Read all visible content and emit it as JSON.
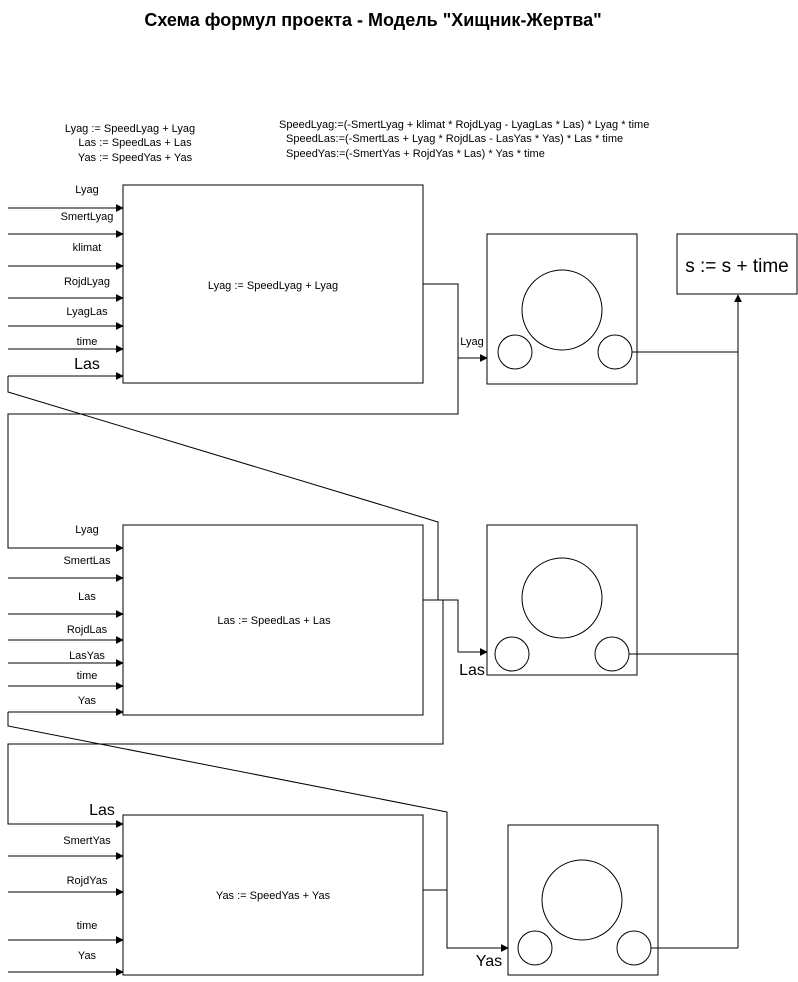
{
  "title": "Схема формул проекта - Модель \"Хищник-Жертва\"",
  "formulas_left": [
    "Lyag := SpeedLyag + Lyag",
    "Las := SpeedLas + Las",
    "Yas := SpeedYas + Yas"
  ],
  "formulas_right": [
    "SpeedLyag:=(-SmertLyag + klimat * RojdLyag - LyagLas * Las) * Lyag * time",
    "SpeedLas:=(-SmertLas + Lyag * RojdLas - LasYas * Yas) * Las * time",
    "SpeedYas:=(-SmertYas + RojdYas * Las) * Yas * time"
  ],
  "block1": {
    "formula": "Lyag := SpeedLyag + Lyag",
    "inputs": [
      "Lyag",
      "SmertLyag",
      "klimat",
      "RojdLyag",
      "LyagLas",
      "time",
      "Las"
    ],
    "output_label": "Lyag"
  },
  "block2": {
    "formula": "Las := SpeedLas + Las",
    "inputs": [
      "Lyag",
      "SmertLas",
      "Las",
      "RojdLas",
      "LasYas",
      "time",
      "Yas"
    ],
    "output_label": "Las"
  },
  "block3": {
    "formula": "Yas := SpeedYas + Yas",
    "inputs": [
      "Las",
      "SmertYas",
      "RojdYas",
      "time",
      "Yas"
    ],
    "output_label": "Yas"
  },
  "time_box": "s := s + time"
}
